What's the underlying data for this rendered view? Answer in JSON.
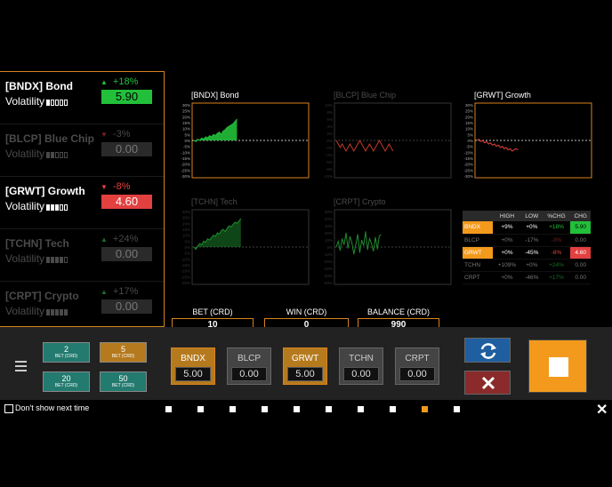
{
  "colors": {
    "accent": "#f39a1c",
    "up": "#22c03a",
    "down": "#e34040"
  },
  "assets": [
    {
      "name": "[BNDX] Bond",
      "vol_label": "Volatility",
      "vol_level": 1,
      "vol_max": 5,
      "dir": "up",
      "change": "+18%",
      "price": "5.90",
      "active": true
    },
    {
      "name": "[BLCP] Blue Chip",
      "vol_label": "Volatility",
      "vol_level": 2,
      "vol_max": 5,
      "dir": "down",
      "change": "-3%",
      "price": "0.00",
      "active": false
    },
    {
      "name": "[GRWT] Growth",
      "vol_label": "Volatility",
      "vol_level": 3,
      "vol_max": 5,
      "dir": "down",
      "change": "-8%",
      "price": "4.60",
      "active": true
    },
    {
      "name": "[TCHN] Tech",
      "vol_label": "Volatility",
      "vol_level": 4,
      "vol_max": 5,
      "dir": "up",
      "change": "+24%",
      "price": "0.00",
      "active": false
    },
    {
      "name": "[CRPT] Crypto",
      "vol_label": "Volatility",
      "vol_level": 5,
      "vol_max": 5,
      "dir": "up",
      "change": "+17%",
      "price": "0.00",
      "active": false
    }
  ],
  "charts": [
    {
      "title": "[BNDX] Bond",
      "active": true,
      "color": "#22c03a",
      "fill": true,
      "y_ticks": [
        "30%",
        "25%",
        "20%",
        "15%",
        "10%",
        "5%",
        "0%",
        "-5%",
        "-10%",
        "-15%",
        "-20%",
        "-25%",
        "-30%"
      ],
      "series": [
        0,
        -1,
        1,
        0,
        2,
        1,
        3,
        2,
        4,
        3,
        5,
        4,
        6,
        7,
        5,
        8,
        9,
        11,
        12,
        13,
        14,
        16,
        18
      ]
    },
    {
      "title": "[BLCP] Blue Chip",
      "active": false,
      "color": "#c0392b",
      "fill": false,
      "y_ticks": [
        "10%",
        "8%",
        "6%",
        "4%",
        "2%",
        "0%",
        "-2%",
        "-4%",
        "-6%",
        "-8%",
        "-10%"
      ],
      "series": [
        0,
        -1,
        -2,
        -1,
        -2,
        -3,
        -2,
        -1,
        -2,
        -3,
        -2,
        -1,
        0,
        -1,
        -2,
        -3,
        -2,
        -1,
        -2,
        -3,
        -2,
        -1,
        0,
        -1,
        -2,
        -3,
        -2,
        -1,
        -2,
        -3
      ]
    },
    {
      "title": "[GRWT] Growth",
      "active": true,
      "color": "#e34040",
      "fill": false,
      "y_ticks": [
        "30%",
        "25%",
        "20%",
        "15%",
        "10%",
        "5%",
        "0%",
        "-5%",
        "-10%",
        "-15%",
        "-20%",
        "-25%",
        "-30%"
      ],
      "series": [
        0,
        1,
        -1,
        0,
        -2,
        -1,
        -3,
        -2,
        -4,
        -3,
        -5,
        -4,
        -6,
        -5,
        -7,
        -6,
        -8,
        -7,
        -9,
        -8,
        -7,
        -8
      ]
    },
    {
      "title": "[TCHN] Tech",
      "active": false,
      "color": "#1e8c2e",
      "fill": true,
      "y_ticks": [
        "30%",
        "25%",
        "20%",
        "15%",
        "10%",
        "5%",
        "0%",
        "-5%",
        "-10%",
        "-15%",
        "-20%",
        "-25%",
        "-30%"
      ],
      "series": [
        0,
        -2,
        1,
        3,
        2,
        5,
        4,
        7,
        6,
        8,
        10,
        9,
        12,
        11,
        14,
        15,
        13,
        16,
        18,
        17,
        19,
        21,
        20,
        22,
        24
      ]
    },
    {
      "title": "[CRPT] Crypto",
      "active": false,
      "color": "#1e8c2e",
      "fill": false,
      "y_ticks": [
        "50%",
        "40%",
        "30%",
        "20%",
        "10%",
        "0%",
        "-10%",
        "-20%",
        "-30%",
        "-40%",
        "-50%"
      ],
      "series": [
        0,
        8,
        -5,
        12,
        3,
        20,
        -2,
        15,
        6,
        -10,
        4,
        18,
        -8,
        10,
        2,
        22,
        -4,
        12,
        5,
        -6,
        14,
        -3,
        16,
        17
      ]
    }
  ],
  "stats": {
    "headers": [
      "",
      "HIGH",
      "LOW",
      "%CHG",
      "CHG"
    ],
    "rows": [
      {
        "sym": "BNDX",
        "high": "+9%",
        "low": "+0%",
        "pct": "+18%",
        "chg": "5.90",
        "active": true,
        "dir": "up"
      },
      {
        "sym": "BLCP",
        "high": "+0%",
        "low": "-17%",
        "pct": "-3%",
        "chg": "0.00",
        "active": false,
        "dir": "down"
      },
      {
        "sym": "GRWT",
        "high": "+0%",
        "low": "-45%",
        "pct": "-8%",
        "chg": "4.60",
        "active": true,
        "dir": "down"
      },
      {
        "sym": "TCHN",
        "high": "+109%",
        "low": "+0%",
        "pct": "+24%",
        "chg": "0.00",
        "active": false,
        "dir": "up"
      },
      {
        "sym": "CRPT",
        "high": "+0%",
        "low": "-46%",
        "pct": "+17%",
        "chg": "0.00",
        "active": false,
        "dir": "up"
      }
    ]
  },
  "meters": {
    "bet_label": "BET (CRD)",
    "bet": "10",
    "win_label": "WIN (CRD)",
    "win": "0",
    "balance_label": "BALANCE (CRD)",
    "balance": "990"
  },
  "chips": [
    {
      "amount": "2",
      "unit": "BET (CRD)",
      "style": "teal"
    },
    {
      "amount": "5",
      "unit": "BET (CRD)",
      "style": "gold"
    },
    {
      "amount": "20",
      "unit": "BET (CRD)",
      "style": "teal"
    },
    {
      "amount": "50",
      "unit": "BET (CRD)",
      "style": "teal"
    }
  ],
  "asset_buttons": [
    {
      "sym": "BNDX",
      "value": "5.00",
      "selected": true
    },
    {
      "sym": "BLCP",
      "value": "0.00",
      "selected": false
    },
    {
      "sym": "GRWT",
      "value": "5.00",
      "selected": true
    },
    {
      "sym": "TCHN",
      "value": "0.00",
      "selected": false
    },
    {
      "sym": "CRPT",
      "value": "0.00",
      "selected": false
    }
  ],
  "footer": {
    "dont_show": "Don't show next time",
    "page_count": 10,
    "active_page": 9
  },
  "icons": {
    "menu": "hamburger-icon",
    "refresh": "refresh-icon",
    "cancel": "close-icon",
    "stop": "stop-icon",
    "close": "close-x-icon"
  }
}
